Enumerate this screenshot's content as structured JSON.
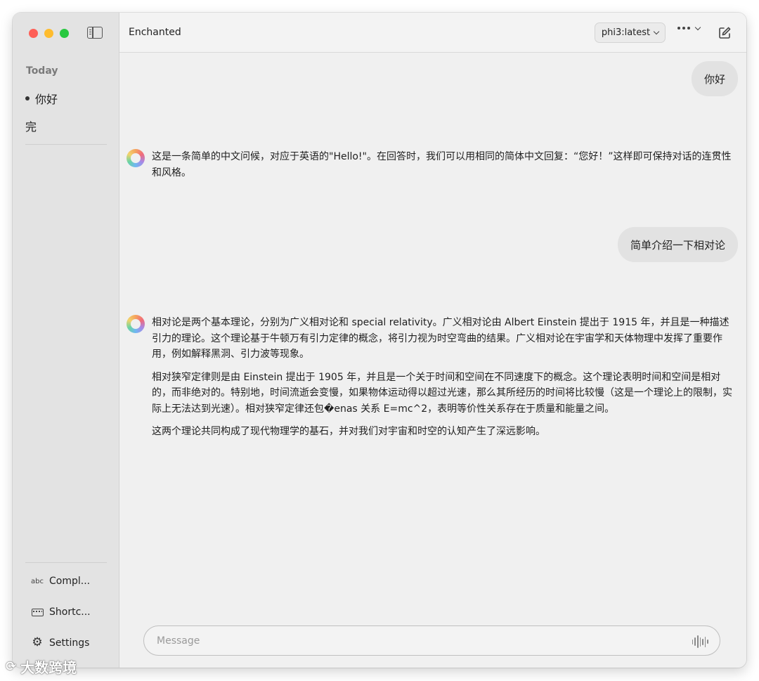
{
  "window": {
    "title": "Enchanted"
  },
  "sidebar": {
    "section_today": "Today",
    "chats": [
      {
        "label": "你好",
        "active": true
      },
      {
        "label": "完",
        "active": false
      }
    ],
    "bottom_items": [
      {
        "label": "Compl...",
        "icon": "abc-icon"
      },
      {
        "label": "Shortc...",
        "icon": "keyboard-icon"
      },
      {
        "label": "Settings",
        "icon": "gear-icon"
      }
    ]
  },
  "toolbar": {
    "model": "phi3:latest"
  },
  "conversation": [
    {
      "role": "user",
      "text": "你好"
    },
    {
      "role": "assistant",
      "paragraphs": [
        "这是一条简单的中文问候，对应于英语的\"Hello!\"。在回答时，我们可以用相同的简体中文回复：“您好！”这样即可保持对话的连贯性和风格。"
      ]
    },
    {
      "role": "user",
      "text": "简单介绍一下相对论"
    },
    {
      "role": "assistant",
      "paragraphs": [
        "相对论是两个基本理论，分别为广义相对论和 special relativity。广义相对论由 Albert Einstein 提出于 1915 年，并且是一种描述引力的理论。这个理论基于牛顿万有引力定律的概念，将引力视为时空弯曲的结果。广义相对论在宇宙学和天体物理中发挥了重要作用，例如解释黑洞、引力波等现象。",
        "相对狭窄定律则是由 Einstein 提出于 1905 年，并且是一个关于时间和空间在不同速度下的概念。这个理论表明时间和空间是相对的，而非绝对的。特别地，时间流逝会变慢，如果物体运动得以超过光速，那么其所经历的时间将比较慢（这是一个理论上的限制，实际上无法达到光速）。相对狭窄定律还包�enas 关系 E=mc^2，表明等价性关系存在于质量和能量之间。",
        "这两个理论共同构成了现代物理学的基石，并对我们对宇宙和时空的认知产生了深远影响。"
      ]
    }
  ],
  "composer": {
    "placeholder": "Message",
    "value": ""
  },
  "watermark": "大数跨境",
  "colors": {
    "close": "#fe5f57",
    "minimize": "#febc2e",
    "zoom": "#28c840",
    "sidebar_bg": "#e3e3e3",
    "main_bg": "#f0f0f0",
    "user_bubble": "#e2e2e2"
  }
}
